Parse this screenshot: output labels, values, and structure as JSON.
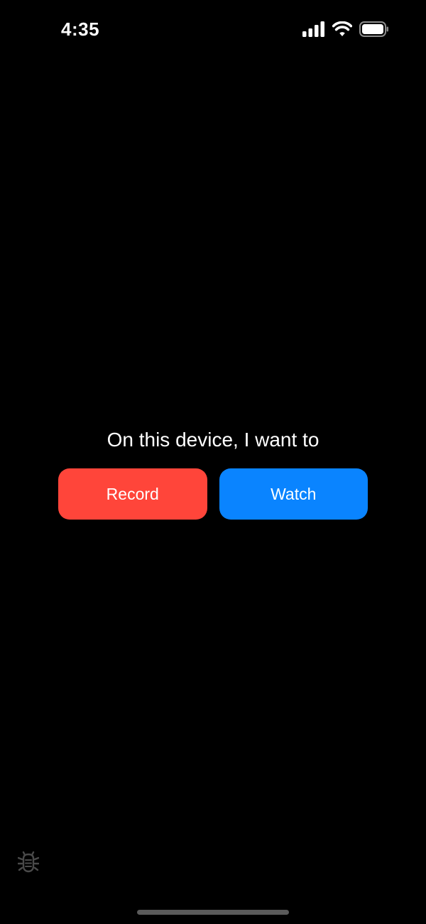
{
  "status_bar": {
    "time": "4:35",
    "icons": [
      "cellular-signal-icon",
      "wifi-icon",
      "battery-icon"
    ]
  },
  "main": {
    "prompt": "On this device, I want to",
    "buttons": [
      {
        "label": "Record",
        "color": "#ff453a"
      },
      {
        "label": "Watch",
        "color": "#0a84ff"
      }
    ]
  },
  "footer": {
    "debug_icon": "bug-icon"
  },
  "colors": {
    "background": "#000000",
    "text": "#ffffff",
    "record": "#ff453a",
    "watch": "#0a84ff",
    "debug_icon": "#4a4a4a",
    "home_indicator": "#5a5a5a"
  }
}
